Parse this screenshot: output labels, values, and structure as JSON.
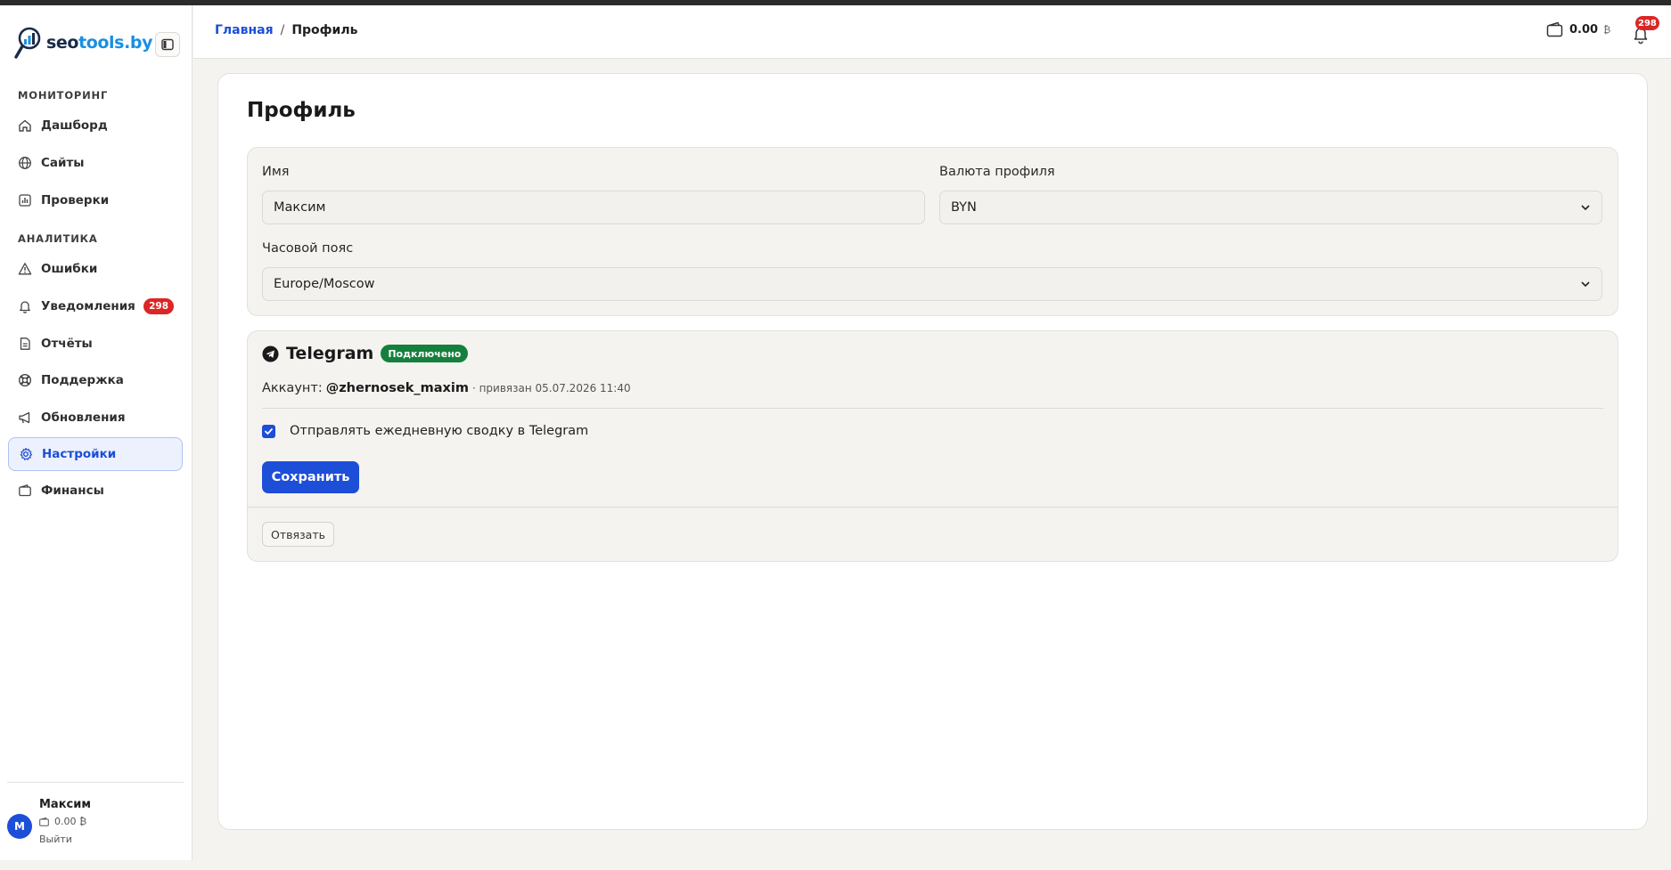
{
  "brand": {
    "logo_part1": "seo",
    "logo_part2": "tools.by"
  },
  "sidebar": {
    "sections": [
      {
        "title": "МОНИТОРИНГ"
      },
      {
        "title": "АНАЛИТИКА"
      }
    ],
    "items": [
      {
        "label": "Дашборд",
        "icon": "home-icon"
      },
      {
        "label": "Сайты",
        "icon": "globe-icon"
      },
      {
        "label": "Проверки",
        "icon": "chart-icon"
      },
      {
        "label": "Ошибки",
        "icon": "warning-icon"
      },
      {
        "label": "Уведомления",
        "icon": "bell-icon",
        "badge": "298"
      },
      {
        "label": "Отчёты",
        "icon": "document-icon"
      },
      {
        "label": "Поддержка",
        "icon": "lifebuoy-icon"
      },
      {
        "label": "Обновления",
        "icon": "megaphone-icon"
      },
      {
        "label": "Настройки",
        "icon": "gear-icon",
        "active": true
      },
      {
        "label": "Финансы",
        "icon": "wallet-icon"
      }
    ],
    "user": {
      "initial": "M",
      "name": "Максим",
      "balance": "0.00 ₿",
      "logout": "Выйти"
    }
  },
  "header": {
    "breadcrumb": {
      "home": "Главная",
      "separator": "/",
      "current": "Профиль"
    },
    "wallet": "0.00",
    "currency_symbol": "₿",
    "notifications_count": "298"
  },
  "profile": {
    "title": "Профиль",
    "name_label": "Имя",
    "name_value": "Максим",
    "currency_label": "Валюта профиля",
    "currency_value": "BYN",
    "timezone_label": "Часовой пояс",
    "timezone_value": "Europe/Moscow"
  },
  "telegram": {
    "title": "Telegram",
    "status": "Подключено",
    "account_label": "Аккаунт:",
    "account_handle": "@zhernosek_maxim",
    "linked_text": "· привязан 05.07.2026 11:40",
    "checkbox_label": "Отправлять ежедневную сводку в Telegram",
    "checkbox_checked": true,
    "save_label": "Сохранить",
    "unlink_label": "Отвязать"
  },
  "colors": {
    "accent": "#1d4ed8",
    "danger": "#dc2626",
    "success": "#15803d",
    "background": "#f4f3f0"
  }
}
